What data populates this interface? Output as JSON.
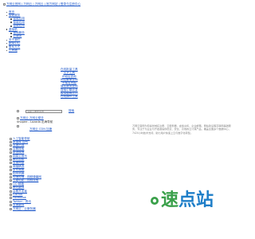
{
  "header": {
    "title": "万网云官网 | 万网云 | 万网云 | 官方网站 | 登录与注册中心"
  },
  "nav": {
    "items": [
      {
        "label": "首页",
        "level": 1
      },
      {
        "label": "智能服务",
        "level": 1
      },
      {
        "label": "智能应用",
        "level": 2
      },
      {
        "label": "智能应用",
        "level": 2
      },
      {
        "label": "智能应用",
        "level": 2
      },
      {
        "label": "虚拟机",
        "level": 1
      },
      {
        "label": "基础服务",
        "level": 2
      },
      {
        "label": "云服务",
        "level": 2
      },
      {
        "label": "关于我们",
        "level": 1
      },
      {
        "label": "新闻中心",
        "level": 1
      },
      {
        "label": "联系方式",
        "level": 1
      },
      {
        "label": "工具箱",
        "level": 1
      }
    ]
  },
  "tools": {
    "items": [
      "在线批量工具",
      "文字工具",
      "IP地址查询",
      "网站备案查询",
      "子域名挖掘",
      "域名服务查询",
      "搜索引擎收录",
      "模拟蜘蛛访问",
      "在线操作工具"
    ]
  },
  "search": {
    "placeholder": "请输入要搜索的",
    "button_label": "搜索"
  },
  "site": {
    "logo_caption": "万网云 万网云助手",
    "sub_caption": "Shopee - Lazada 出海导航",
    "ad_line": "万网云 CDN 加速"
  },
  "friend_links": {
    "items": [
      "人工智能导航",
      "数据库 百科",
      "百度热搜",
      "谷歌搜索",
      "新浪微博",
      "网易云音乐",
      "腾讯视频",
      "百度网盘",
      "淘宝精选",
      "京东商城",
      "知乎热榜",
      "哔哩哔哩 - 视频弹幕网",
      "豆瓣电影 - 视频搜索",
      "QQ 邮箱",
      "腾讯翻译",
      "谷歌开发者",
      "GitHub",
      "Facebook",
      "Twitter - 资讯",
      "百度翻译",
      "万网云 - 云服务器"
    ]
  },
  "description": {
    "text": "万网云官网为您提供域名注册、云服务器、虚拟主机、企业邮箱、网站建设等互联网基础服务，专注于为企业与开发者提供稳定、安全、高效的云计算产品，覆盖全国多个数据中心，7x24小时技术支持，助力用户快速上云与数字化转型。"
  },
  "brand_logo": {
    "text": "速点站",
    "colors": {
      "green": "#3aa04a",
      "blue": "#1e7ec8"
    }
  }
}
